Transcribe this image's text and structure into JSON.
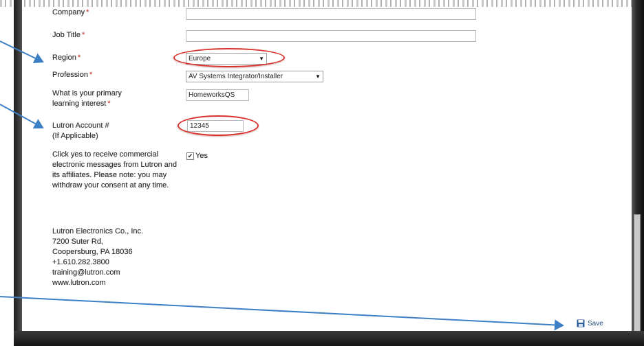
{
  "form": {
    "company": {
      "label": "Company",
      "required_mark": "*",
      "value": ""
    },
    "job_title": {
      "label": "Job Title",
      "required_mark": "*",
      "value": ""
    },
    "region": {
      "label": "Region",
      "required_mark": "*",
      "selected": "Europe"
    },
    "profession": {
      "label": "Profession",
      "required_mark": "*",
      "selected": "AV Systems Integrator/Installer"
    },
    "learning_interest": {
      "label": "What is your primary learning interest",
      "required_mark": "*",
      "value": "HomeworksQS"
    },
    "account": {
      "label_line1": "Lutron Account #",
      "label_line2": "(If Applicable)",
      "value": "12345"
    },
    "consent": {
      "text": "Click yes to receive commercial electronic messages from Lutron and its affiliates. Please note: you may withdraw your consent at any time.",
      "checked": true,
      "option_label": "Yes"
    },
    "address": {
      "company": "Lutron Electronics Co., Inc.",
      "street": "7200 Suter Rd,",
      "city": "Coopersburg, PA 18036",
      "phone": "+1.610.282.3800",
      "email": "training@lutron.com",
      "website": "www.lutron.com"
    }
  },
  "actions": {
    "save_label": "Save",
    "save_icon": "floppy-disk-icon"
  },
  "annotations": {
    "arrow_color": "#3d7fc4",
    "highlight_color": "#d8302a"
  }
}
